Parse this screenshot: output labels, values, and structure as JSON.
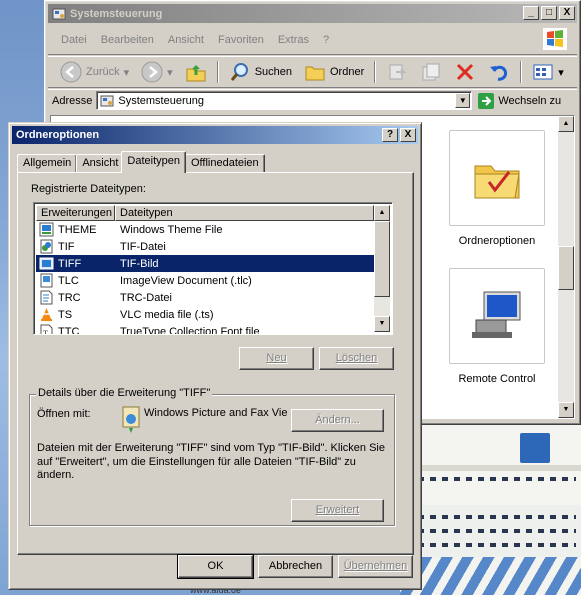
{
  "background_window": {
    "title": "Systemsteuerung",
    "title_buttons": [
      "_",
      "□",
      "X"
    ],
    "menu": [
      "Datei",
      "Bearbeiten",
      "Ansicht",
      "Favoriten",
      "Extras",
      "?"
    ],
    "toolbar": {
      "back": "Zurück",
      "search": "Suchen",
      "folders": "Ordner"
    },
    "address": {
      "label": "Adresse",
      "value": "Systemsteuerung",
      "go": "Wechseln zu"
    },
    "items": [
      {
        "label": "Ordneroptionen",
        "icon": "folder-options-icon"
      },
      {
        "label": "Remote Control",
        "icon": "remote-control-icon"
      }
    ]
  },
  "dialog": {
    "title": "Ordneroptionen",
    "title_buttons": [
      "?",
      "X"
    ],
    "tabs": [
      "Allgemein",
      "Ansicht",
      "Dateitypen",
      "Offlinedateien"
    ],
    "active_tab": "Dateitypen",
    "registered_label": "Registrierte Dateitypen:",
    "columns": [
      "Erweiterungen",
      "Dateitypen"
    ],
    "rows": [
      {
        "ext": "THEME",
        "type": "Windows Theme File",
        "icon": "theme-file-icon"
      },
      {
        "ext": "TIF",
        "type": "TIF-Datei",
        "icon": "tif-file-icon"
      },
      {
        "ext": "TIFF",
        "type": "TIF-Bild",
        "icon": "tiff-file-icon",
        "selected": true
      },
      {
        "ext": "TLC",
        "type": "ImageView Document (.tlc)",
        "icon": "tlc-file-icon"
      },
      {
        "ext": "TRC",
        "type": "TRC-Datei",
        "icon": "trc-file-icon"
      },
      {
        "ext": "TS",
        "type": "VLC media file (.ts)",
        "icon": "vlc-cone-icon"
      },
      {
        "ext": "TTC",
        "type": "TrueType Collection Font file",
        "icon": "font-file-icon"
      }
    ],
    "btn_new": "Neu",
    "btn_delete": "Löschen",
    "details_title": "Details über die Erweiterung \"TIFF\"",
    "open_with_label": "Öffnen mit:",
    "open_with_app": "Windows Picture and Fax Vie",
    "btn_change": "Ändern...",
    "description": "Dateien mit der Erweiterung \"TIFF\" sind vom Typ \"TIF-Bild\". Klicken Sie auf \"Erweitert\", um die Einstellungen für alle Dateien \"TIF-Bild\" zu ändern.",
    "btn_advanced": "Erweitert",
    "btn_ok": "OK",
    "btn_cancel": "Abbrechen",
    "btn_apply": "Übernehmen"
  },
  "desktop": {
    "watermark": "www.aida.de"
  },
  "colors": {
    "selection": "#0a246a",
    "face": "#d4d0c8",
    "inactive_title": "#808080"
  }
}
